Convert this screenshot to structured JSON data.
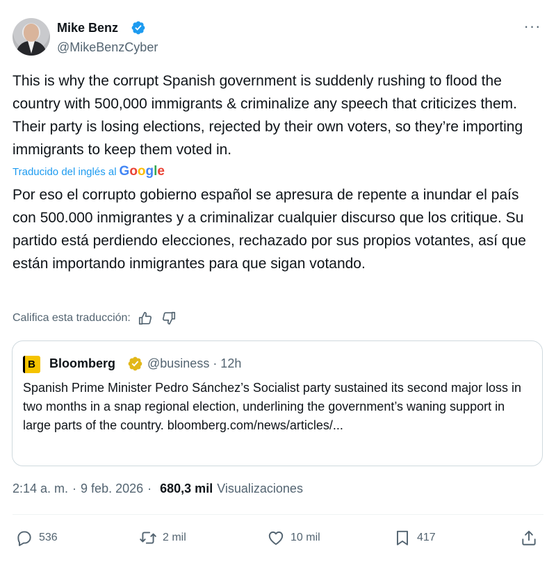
{
  "author": {
    "name": "Mike Benz",
    "handle": "@MikeBenzCyber",
    "verified_color": "#1d9bf0"
  },
  "more_menu": "···",
  "tweet": {
    "text": "This is why the corrupt Spanish government is suddenly rushing to flood the country with 500,000 immigrants & criminalize any speech that criticizes them. Their party is losing elections, rejected by their own voters, so they’re importing immigrants to keep them voted in.",
    "translated_label": "Traducido del inglés al",
    "translation_provider": "Google",
    "translation": "Por eso el corrupto gobierno español se apresura de repente a inundar el país con 500.000 inmigrantes y a criminalizar cualquier discurso que los critique. Su partido está perdiendo elecciones, rechazado por sus propios votantes, así que están importando inmigrantes para que sigan votando.",
    "rate_label": "Califica esta traducción:"
  },
  "quote": {
    "logo_letter": "B",
    "name": "Bloomberg",
    "handle": "@business · 12h",
    "text": "Spanish Prime Minister Pedro Sánchez’s Socialist party sustained its second major loss in two months in a snap regional election, underlining the government’s waning support in large parts of the country. bloomberg.com/news/articles/...",
    "badge_color": "#e2b719"
  },
  "meta": {
    "time": "2:14 a. m.",
    "separator": "·",
    "date": "9 feb. 2026",
    "separator2": "·",
    "views_count": "680,3 mil",
    "views_label": "Visualizaciones"
  },
  "actions": {
    "replies": "536",
    "reposts": "2 mil",
    "likes": "10 mil",
    "bookmarks": "417"
  },
  "colors": {
    "text": "#0f1419",
    "secondary": "#536471",
    "link": "#1d9bf0",
    "border": "#cfd9de"
  }
}
